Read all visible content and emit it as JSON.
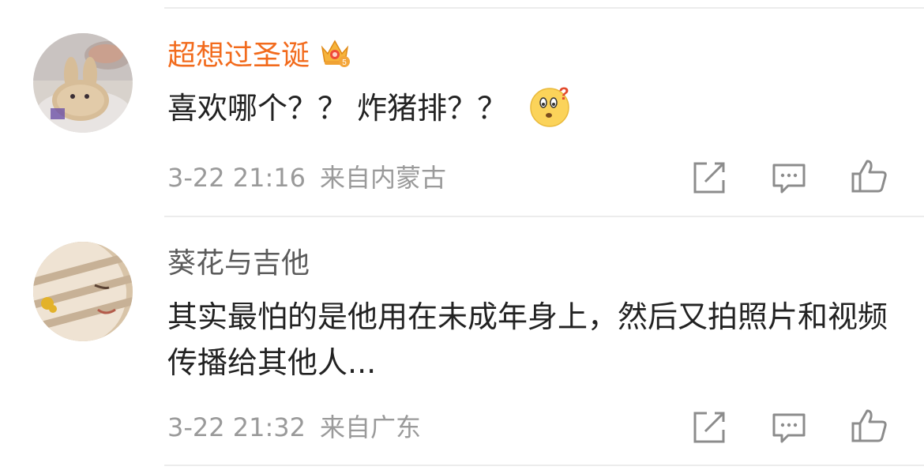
{
  "comments": [
    {
      "username": "超想过圣诞",
      "badge_icon": "vip-crown-icon",
      "text": "喜欢哪个？？ 炸猪排？？",
      "emoji_icon": "confused-face-emoji-icon",
      "time": "3-22 21:16",
      "location": "来自内蒙古",
      "actions": [
        "share-icon",
        "comment-icon",
        "like-icon"
      ]
    },
    {
      "username": "葵花与吉他",
      "text": "其实最怕的是他用在未成年身上，然后又拍照片和视频传播给其他人...",
      "time": "3-22 21:32",
      "location": "来自广东",
      "actions": [
        "share-icon",
        "comment-icon",
        "like-icon"
      ]
    }
  ],
  "colors": {
    "vip_username": "#f26b1d",
    "username": "#5b5b5b",
    "text": "#222222",
    "meta": "#9a9a9a",
    "icon": "#8c8c8c",
    "divider": "#ececec"
  }
}
